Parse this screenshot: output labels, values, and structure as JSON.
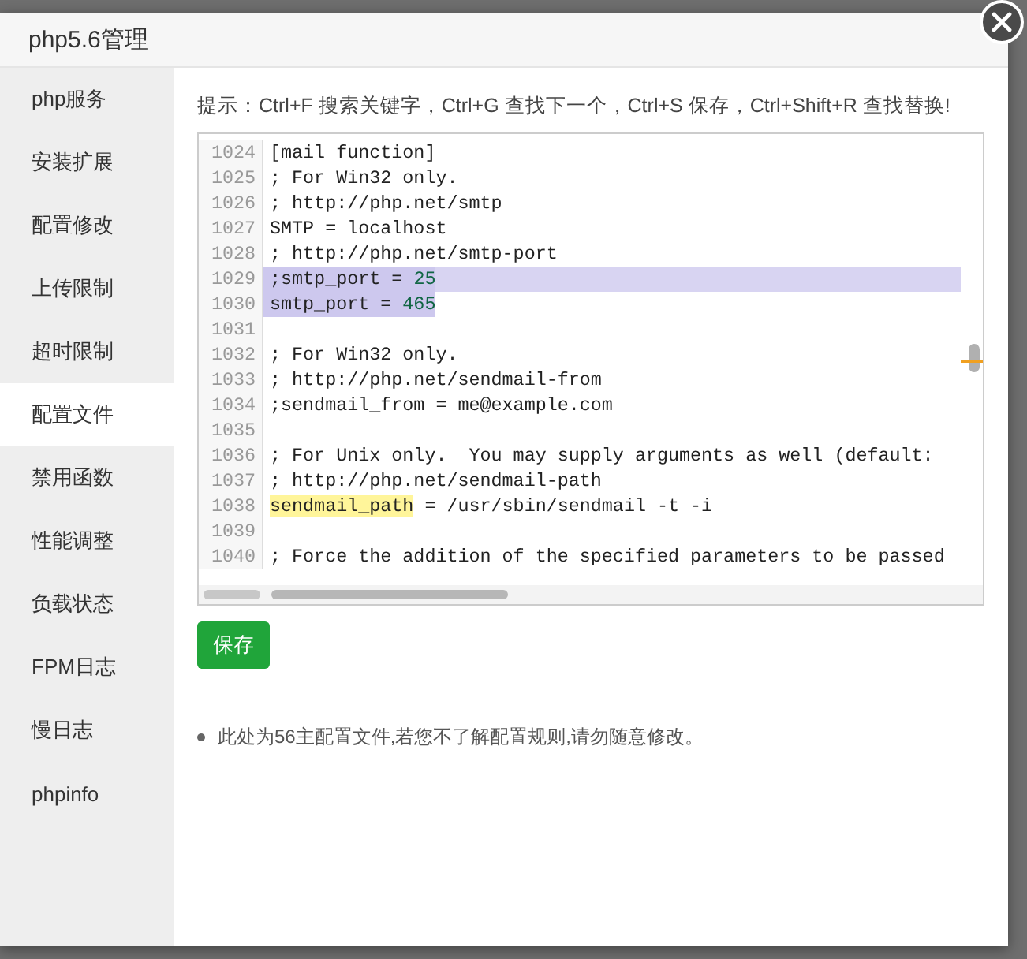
{
  "window": {
    "title": "php5.6管理"
  },
  "sidebar": {
    "items": [
      {
        "label": "php服务",
        "selected": false
      },
      {
        "label": "安装扩展",
        "selected": false
      },
      {
        "label": "配置修改",
        "selected": false
      },
      {
        "label": "上传限制",
        "selected": false
      },
      {
        "label": "超时限制",
        "selected": false
      },
      {
        "label": "配置文件",
        "selected": true
      },
      {
        "label": "禁用函数",
        "selected": false
      },
      {
        "label": "性能调整",
        "selected": false
      },
      {
        "label": "负载状态",
        "selected": false
      },
      {
        "label": "FPM日志",
        "selected": false
      },
      {
        "label": "慢日志",
        "selected": false
      },
      {
        "label": "phpinfo",
        "selected": false
      }
    ]
  },
  "hint": "提示：Ctrl+F 搜索关键字，Ctrl+G 查找下一个，Ctrl+S 保存，Ctrl+Shift+R 查找替换!",
  "editor": {
    "lines": [
      {
        "number": "1024",
        "selected": false,
        "line_end_selected": false,
        "parts": [
          {
            "kind": "plain",
            "text": "[mail function]"
          }
        ]
      },
      {
        "number": "1025",
        "selected": false,
        "line_end_selected": false,
        "parts": [
          {
            "kind": "plain",
            "text": "; For Win32 only."
          }
        ]
      },
      {
        "number": "1026",
        "selected": false,
        "line_end_selected": false,
        "parts": [
          {
            "kind": "plain",
            "text": "; http://php.net/smtp"
          }
        ]
      },
      {
        "number": "1027",
        "selected": false,
        "line_end_selected": false,
        "parts": [
          {
            "kind": "plain",
            "text": "SMTP = localhost"
          }
        ]
      },
      {
        "number": "1028",
        "selected": false,
        "line_end_selected": false,
        "parts": [
          {
            "kind": "plain",
            "text": "; http://php.net/smtp-port"
          }
        ]
      },
      {
        "number": "1029",
        "selected": true,
        "line_end_selected": true,
        "parts": [
          {
            "kind": "plain",
            "text": ";smtp_port = "
          },
          {
            "kind": "number",
            "text": "25"
          }
        ]
      },
      {
        "number": "1030",
        "selected": true,
        "line_end_selected": false,
        "parts": [
          {
            "kind": "plain",
            "text": "smtp_port = "
          },
          {
            "kind": "number",
            "text": "465"
          }
        ]
      },
      {
        "number": "1031",
        "selected": false,
        "line_end_selected": false
      },
      {
        "number": "1032",
        "selected": false,
        "line_end_selected": false,
        "parts": [
          {
            "kind": "plain",
            "text": "; For Win32 only."
          }
        ]
      },
      {
        "number": "1033",
        "selected": false,
        "line_end_selected": false,
        "parts": [
          {
            "kind": "plain",
            "text": "; http://php.net/sendmail-from"
          }
        ]
      },
      {
        "number": "1034",
        "selected": false,
        "line_end_selected": false,
        "parts": [
          {
            "kind": "plain",
            "text": ";sendmail_from = me@example.com"
          }
        ]
      },
      {
        "number": "1035",
        "selected": false,
        "line_end_selected": false
      },
      {
        "number": "1036",
        "selected": false,
        "line_end_selected": false,
        "parts": [
          {
            "kind": "plain",
            "text": "; For Unix only.  You may supply arguments as well (default:"
          }
        ]
      },
      {
        "number": "1037",
        "selected": false,
        "line_end_selected": false,
        "parts": [
          {
            "kind": "plain",
            "text": "; http://php.net/sendmail-path"
          }
        ]
      },
      {
        "number": "1038",
        "selected": false,
        "line_end_selected": false,
        "parts": [
          {
            "kind": "match",
            "text": "sendmail_path"
          },
          {
            "kind": "plain",
            "text": " = /usr/sbin/sendmail -t -i"
          }
        ]
      },
      {
        "number": "1039",
        "selected": false,
        "line_end_selected": false
      },
      {
        "number": "1040",
        "selected": false,
        "line_end_selected": false,
        "parts": [
          {
            "kind": "plain",
            "text": "; Force the addition of the specified parameters to be passed"
          }
        ]
      }
    ]
  },
  "save_button": "保存",
  "notes": [
    "此处为56主配置文件,若您不了解配置规则,请勿随意修改。"
  ]
}
